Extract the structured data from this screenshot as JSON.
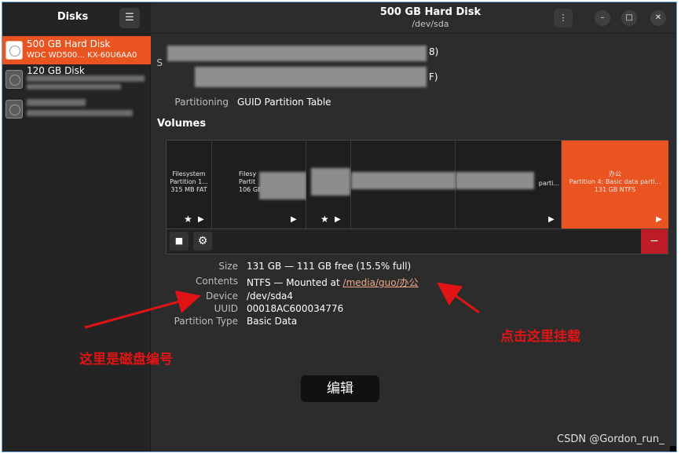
{
  "sidebar": {
    "title": "Disks",
    "menu_glyph": "☰",
    "disks": [
      {
        "name": "500 GB Hard Disk",
        "model": "WDC WD500... KX-60U6AA0",
        "selected": true
      },
      {
        "name": "120 GB Disk",
        "model": "SSD",
        "selected": false
      },
      {
        "name": "",
        "model": "SSD",
        "selected": false
      }
    ]
  },
  "header": {
    "title": "500 GB Hard Disk",
    "subtitle": "/dev/sda",
    "kebab_glyph": "⋮",
    "minimize_glyph": "–",
    "maximize_glyph": "□",
    "close_glyph": "✕"
  },
  "disk_info": {
    "row1_left": "S",
    "row1_right": "8)",
    "row2_right": "F)",
    "partitioning_label": "Partitioning",
    "partitioning_value": "GUID Partition Table"
  },
  "volumes": {
    "title": "Volumes",
    "partitions": [
      {
        "line1": "Filesystem",
        "line2": "Partition 1...",
        "line3": "315 MB FAT"
      },
      {
        "line1": "Filesy",
        "line2": "Partit",
        "line3": "106 GE"
      },
      {
        "line1": "",
        "line2": "",
        "line3": ""
      },
      {
        "line1": "",
        "line2": "",
        "line3": ""
      },
      {
        "line1": "",
        "line2": "parti...",
        "line3": ""
      },
      {
        "line1": "办公",
        "line2": "Partition 4: Basic data parti...",
        "line3": "131 GB NTFS"
      }
    ],
    "stop_glyph": "■",
    "gear_glyph": "⚙",
    "minus_glyph": "−"
  },
  "details": {
    "size_label": "Size",
    "size_value": "131 GB — 111 GB free (15.5% full)",
    "contents_label": "Contents",
    "contents_prefix": "NTFS — Mounted at ",
    "mount_link": "/media/guo/办公",
    "device_label": "Device",
    "device_value": "/dev/sda4",
    "uuid_label": "UUID",
    "uuid_value": "00018AC600034776",
    "ptype_label": "Partition Type",
    "ptype_value": "Basic Data"
  },
  "annotations": {
    "device_note": "这里是磁盘编号",
    "mount_note": "点击这里挂载",
    "edit_button": "编辑",
    "color": "#e01414"
  },
  "watermark": "CSDN @Gordon_run_",
  "colors": {
    "accent": "#e95420",
    "danger": "#c01c28",
    "link": "#f0a88a"
  }
}
